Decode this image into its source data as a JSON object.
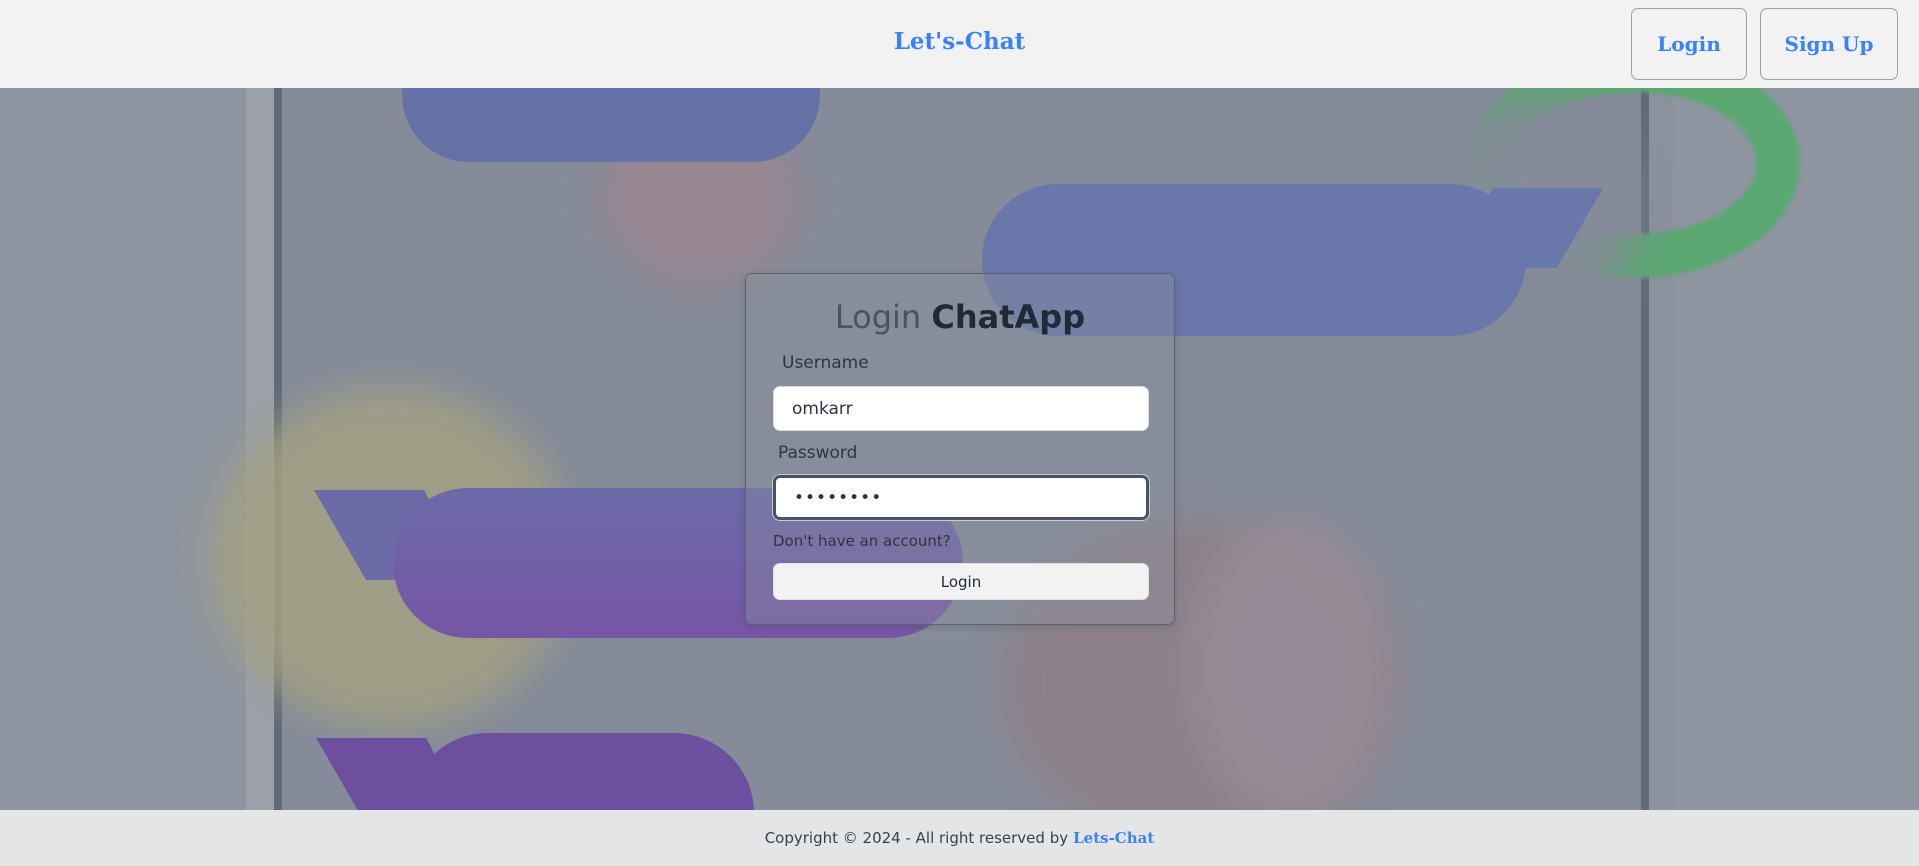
{
  "header": {
    "brand": "Let's-Chat",
    "login_label": "Login",
    "signup_label": "Sign Up"
  },
  "card": {
    "title_light": "Login",
    "title_bold": "ChatApp",
    "username_label": "Username",
    "username_value": "omkarr",
    "password_label": "Password",
    "password_value": "••••••••",
    "no_account_text": "Don't have an account?",
    "login_button": "Login"
  },
  "footer": {
    "copyright_text": "Copyright © 2024 - All right reserved by",
    "brand_link": "Lets-Chat"
  },
  "colors": {
    "accent": "#3b82f6",
    "header_bg": "#f2f2f2",
    "footer_bg": "#e4e5e6"
  }
}
